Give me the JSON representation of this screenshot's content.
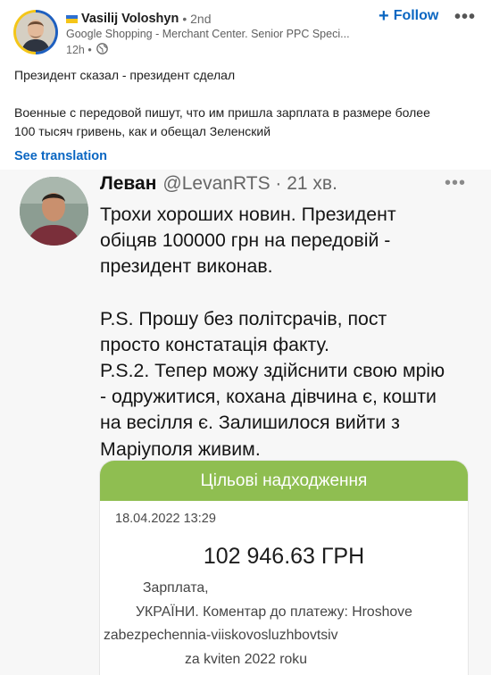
{
  "post": {
    "author": {
      "flag_colors": [
        "#2d6fd1",
        "#f5c518"
      ],
      "name": "Vasilij Voloshyn",
      "degree": "• 2nd",
      "headline": "Google Shopping - Merchant Center. Senior PPC Speci...",
      "time": "12h •",
      "visibility_icon": "globe-icon"
    },
    "follow_label": "Follow",
    "more_icon": "more-options-icon",
    "text_lines": [
      "Президент сказал - президент сделал",
      "Военные с передовой пишут, что им пришла зарплата в размере более",
      "100 тысяч гривень, как и обещал Зеленский"
    ],
    "see_translation": "See translation"
  },
  "tweet": {
    "name": "Леван",
    "handle": "@LevanRTS · 21 хв.",
    "more_icon": "more-options-icon",
    "lines": [
      "Трохи хороших новин. Президент",
      "обіцяв 100000 грн на передовій -",
      "президент виконав.",
      "P.S. Прошу без політсрачів, пост",
      "просто констатація факту.",
      "P.S.2. Тепер можу здійснити свою мрію",
      "- одружитися, кохана дівчина є, кошти",
      "на весілля є. Залишилося вийти з",
      "Маріуполя живим."
    ]
  },
  "receipt": {
    "header": "Цільові надходження",
    "header_color": "#8fbe51",
    "date": "18.04.2022 13:29",
    "amount": "102 946.63 ГРН",
    "desc_lines": [
      "Зарплата,",
      "УКРАЇНИ. Коментар до платежу: Hroshove",
      "zabezpechennia-viiskovosluzhbovtsiv",
      "za kviten 2022 roku"
    ]
  },
  "colors": {
    "link_blue": "#0a66c2"
  }
}
